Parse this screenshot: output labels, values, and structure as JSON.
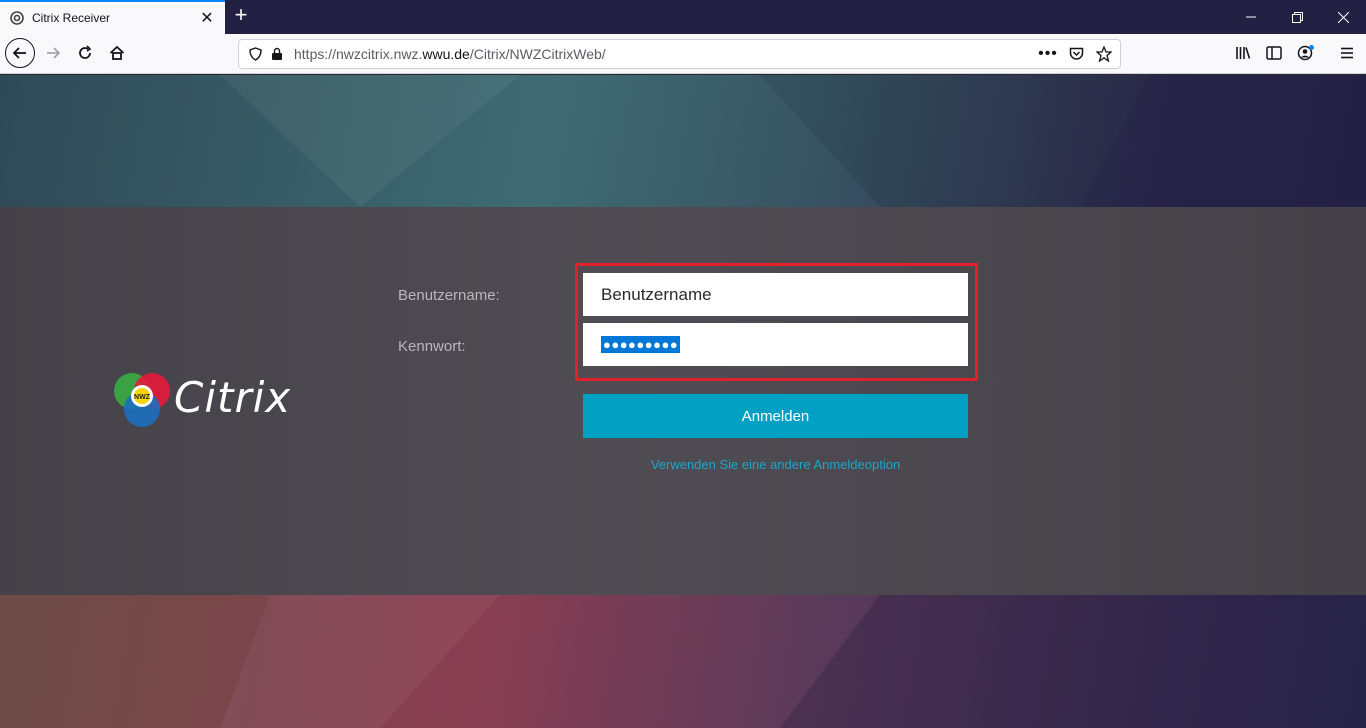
{
  "browser": {
    "tab_title": "Citrix Receiver",
    "url_prefix": "https://nwzcitrix.nwz.",
    "url_domain": "wwu.de",
    "url_path": "/Citrix/NWZCitrixWeb/"
  },
  "logo": {
    "badge_text": "NWZ",
    "brand_text": "Citrix"
  },
  "login": {
    "username_label": "Benutzername:",
    "username_value": "Benutzername",
    "password_label": "Kennwort:",
    "password_value": "●●●●●●●●●",
    "login_button": "Anmelden",
    "alt_option_link": "Verwenden Sie eine andere Anmeldeoption"
  },
  "colors": {
    "accent": "#02a1c4",
    "highlight_border": "#e0212b",
    "link": "#1ba7c9"
  }
}
